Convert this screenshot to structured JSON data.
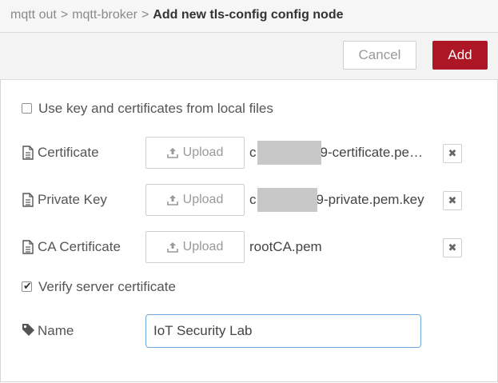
{
  "breadcrumb": {
    "items": [
      "mqtt out",
      "mqtt-broker"
    ],
    "separator": ">",
    "current": "Add new tls-config config node"
  },
  "toolbar": {
    "cancel_label": "Cancel",
    "add_label": "Add",
    "add_color": "#ad1625"
  },
  "form": {
    "local_files": {
      "label": "Use key and certificates from local files",
      "checked": false
    },
    "certificate": {
      "label": "Certificate",
      "upload_label": "Upload",
      "filename_prefix": "c",
      "filename_suffix": "9-certificate.pe…",
      "remove_glyph": "✖"
    },
    "private_key": {
      "label": "Private Key",
      "upload_label": "Upload",
      "filename_prefix": "c",
      "filename_suffix": "9-private.pem.key",
      "remove_glyph": "✖"
    },
    "ca_certificate": {
      "label": "CA Certificate",
      "upload_label": "Upload",
      "filename": "rootCA.pem",
      "remove_glyph": "✖"
    },
    "verify_server": {
      "label": "Verify server certificate",
      "checked": true,
      "check_glyph": "✔"
    },
    "name": {
      "label": "Name",
      "value": "IoT Security Lab"
    }
  },
  "icons": [
    "file-icon",
    "upload-icon",
    "remove-icon",
    "tag-icon",
    "checkbox"
  ]
}
